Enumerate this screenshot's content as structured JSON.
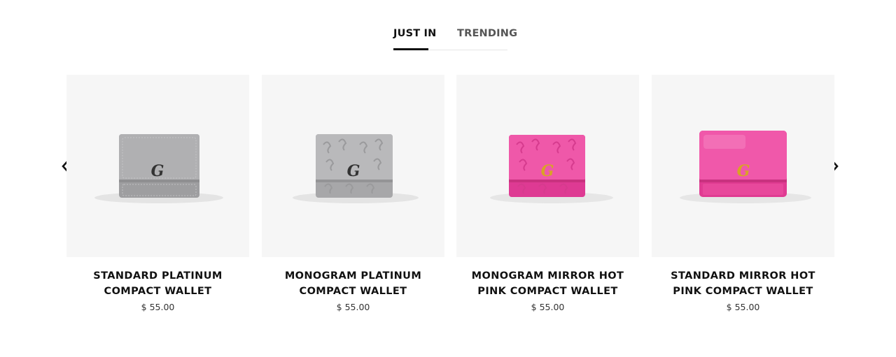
{
  "tabs": [
    {
      "label": "JUST IN",
      "active": true
    },
    {
      "label": "TRENDING",
      "active": false
    }
  ],
  "carousel": {
    "prev_icon": "chevron-left-icon",
    "next_icon": "chevron-right-icon"
  },
  "products": [
    {
      "title": "STANDARD PLATINUM COMPACT WALLET",
      "price": "$ 55.00",
      "color": "#a9a9ab",
      "finish": "standard"
    },
    {
      "title": "MONOGRAM PLATINUM COMPACT WALLET",
      "price": "$ 55.00",
      "color": "#b4b4b6",
      "finish": "monogram"
    },
    {
      "title": "MONOGRAM MIRROR HOT PINK COMPACT WALLET",
      "price": "$ 55.00",
      "color": "#ec4fa4",
      "finish": "monogram"
    },
    {
      "title": "STANDARD MIRROR HOT PINK COMPACT WALLET",
      "price": "$ 55.00",
      "color": "#ee4aa2",
      "finish": "standard"
    }
  ]
}
